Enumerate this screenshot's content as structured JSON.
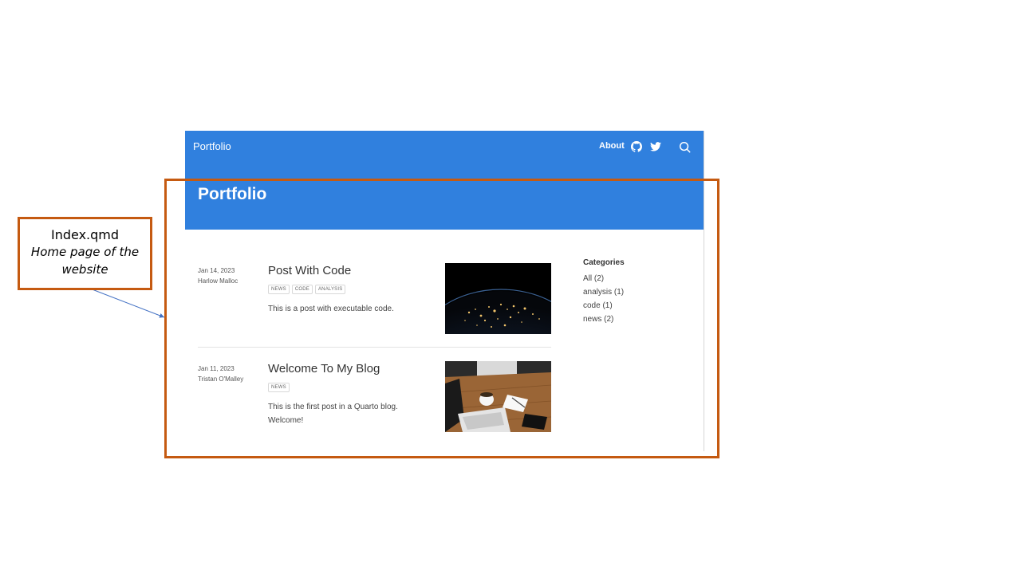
{
  "site": {
    "navbar": {
      "brand": "Portfolio",
      "about_label": "About",
      "icons": [
        "github-icon",
        "twitter-icon",
        "search-icon"
      ],
      "color": "#3080de"
    },
    "banner": {
      "title": "Portfolio"
    },
    "posts": [
      {
        "date": "Jan 14, 2023",
        "author": "Harlow Malloc",
        "title": "Post With Code",
        "tags": [
          "NEWS",
          "CODE",
          "ANALYSIS"
        ],
        "description": "This is a post with executable code.",
        "thumbnail": "earth-at-night-image"
      },
      {
        "date": "Jan 11, 2023",
        "author": "Tristan O'Malley",
        "title": "Welcome To My Blog",
        "tags": [
          "NEWS"
        ],
        "description": "This is the first post in a Quarto blog. Welcome!",
        "thumbnail": "desk-laptop-image"
      }
    ],
    "categories": {
      "title": "Categories",
      "items": [
        "All (2)",
        "analysis (1)",
        "code (1)",
        "news (2)"
      ]
    }
  },
  "annotation": {
    "title": "Index.qmd",
    "subtitle": "Home page of the website",
    "color": "#c55a11"
  }
}
